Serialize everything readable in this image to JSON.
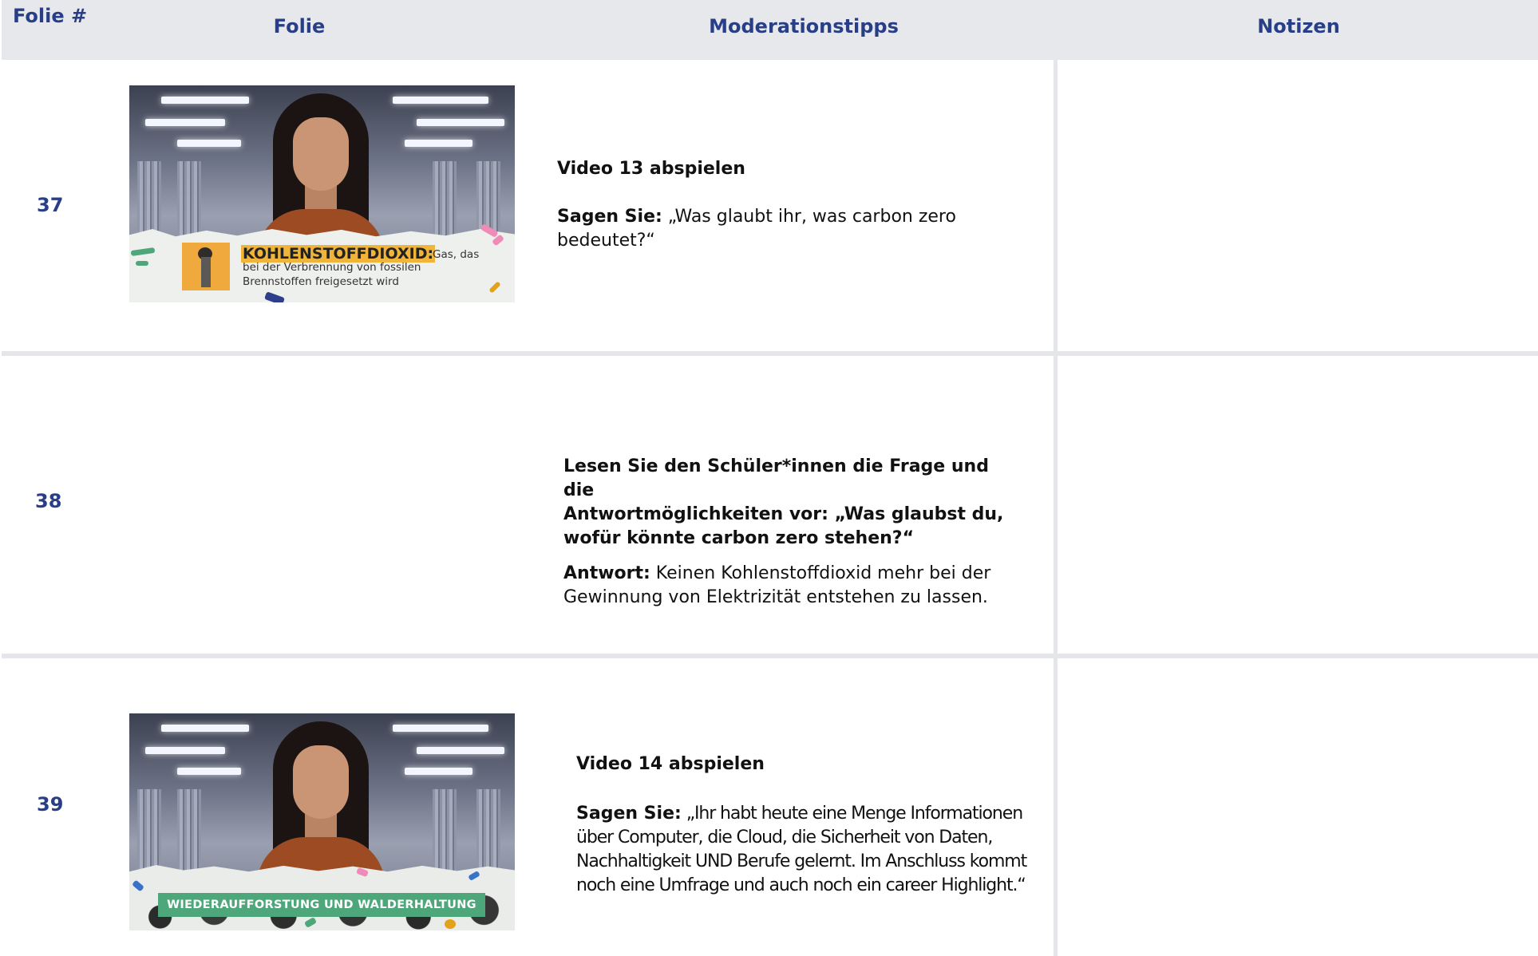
{
  "header": {
    "slide_num_label": "Folie #",
    "slide_label": "Folie",
    "tips_label": "Moderationstipps",
    "notes_label": "Notizen"
  },
  "rows": [
    {
      "number": "37",
      "thumbnail": {
        "caption_highlight": "KOHLENSTOFFDIOXID:",
        "caption_line1": "Gas, das",
        "caption_line2": "bei der Verbrennung von fossilen",
        "caption_line3": "Brennstoffen freigesetzt wird"
      },
      "tips": {
        "action": "Video 13 abspielen",
        "say_label": "Sagen Sie:",
        "say_line1": " „Was glaubt ihr, was carbon zero",
        "say_line2": "bedeutet?“"
      },
      "notes": ""
    },
    {
      "number": "38",
      "tips": {
        "q_line1": "Lesen Sie den Schüler*innen die Frage und die",
        "q_line2": "Antwortmöglichkeiten vor: „Was glaubst du,",
        "q_line3": "wofür könnte carbon zero stehen?“",
        "answer_label": "Antwort:",
        "answer_line1": " Keinen Kohlenstoffdioxid mehr bei der",
        "answer_line2": "Gewinnung von Elektrizität entstehen zu lassen."
      },
      "notes": ""
    },
    {
      "number": "39",
      "thumbnail": {
        "banner": "WIEDERAUFFORSTUNG UND WALDERHALTUNG"
      },
      "tips": {
        "action": "Video 14 abspielen",
        "say_label": "Sagen Sie:",
        "say_line1": " „Ihr habt heute eine Menge Informationen",
        "say_line2": "über Computer, die Cloud, die Sicherheit von Daten,",
        "say_line3": "Nachhaltigkeit UND Berufe gelernt. Im Anschluss kommt",
        "say_line4": "noch eine Umfrage und auch noch ein career Highlight.“"
      },
      "notes": ""
    }
  ],
  "colors": {
    "header_bg": "#e6e8eb",
    "header_text": "#283e86",
    "divider": "#e4e6e9",
    "caption_highlight": "#f0b43b",
    "banner_green": "#4ea77b"
  }
}
